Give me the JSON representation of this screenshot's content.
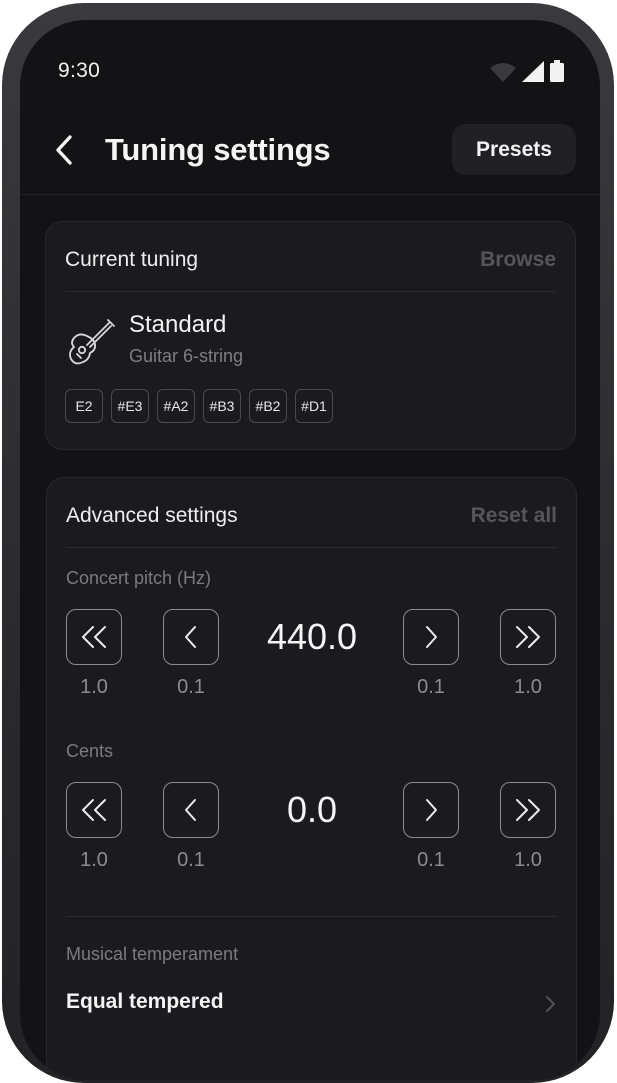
{
  "status": {
    "time": "9:30"
  },
  "header": {
    "title": "Tuning settings",
    "presets_label": "Presets"
  },
  "current_tuning": {
    "heading": "Current tuning",
    "browse_label": "Browse",
    "name": "Standard",
    "instrument": "Guitar 6-string",
    "notes": [
      "E2",
      "#E3",
      "#A2",
      "#B3",
      "#B2",
      "#D1"
    ]
  },
  "advanced": {
    "heading": "Advanced settings",
    "reset_label": "Reset all",
    "concert_pitch": {
      "label": "Concert pitch (Hz)",
      "value": "440.0",
      "steps": {
        "big_down": "1.0",
        "small_down": "0.1",
        "small_up": "0.1",
        "big_up": "1.0"
      }
    },
    "cents": {
      "label": "Cents",
      "value": "0.0",
      "steps": {
        "big_down": "1.0",
        "small_down": "0.1",
        "small_up": "0.1",
        "big_up": "1.0"
      }
    },
    "temperament": {
      "label": "Musical temperament",
      "value": "Equal tempered"
    }
  }
}
